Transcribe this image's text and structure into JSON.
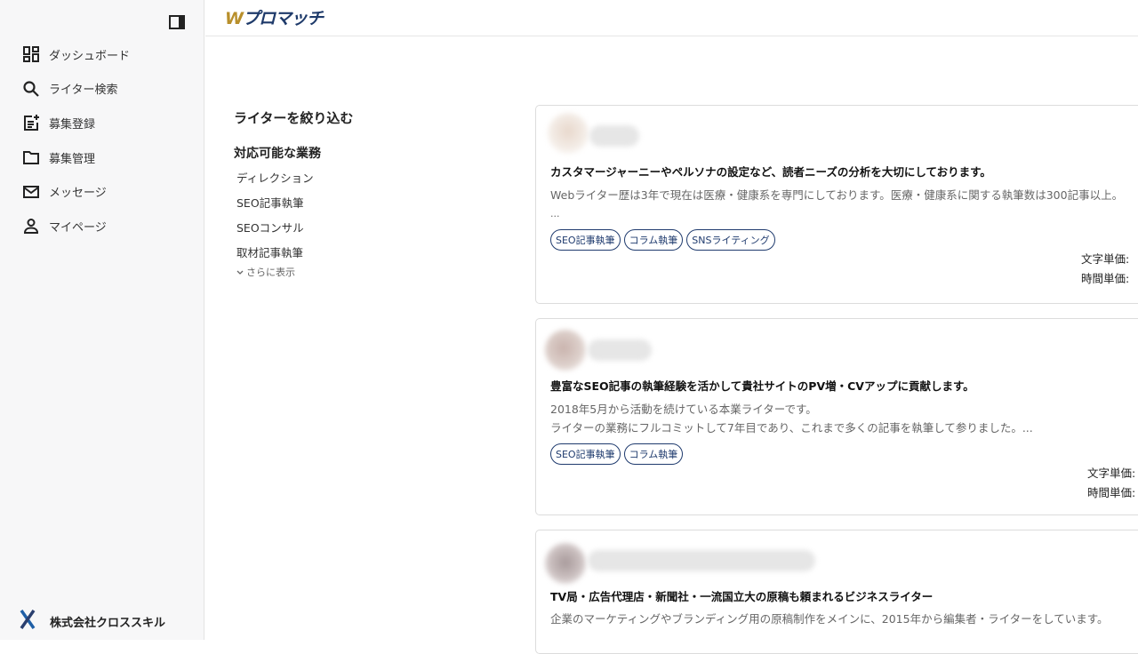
{
  "logo": {
    "w": "W",
    "rest": "プロマッチ"
  },
  "sidebar": {
    "items": [
      {
        "icon": "dashboard-icon",
        "label": "ダッシュボード"
      },
      {
        "icon": "search-icon",
        "label": "ライター検索"
      },
      {
        "icon": "post-add-icon",
        "label": "募集登録"
      },
      {
        "icon": "folder-icon",
        "label": "募集管理"
      },
      {
        "icon": "mail-icon",
        "label": "メッセージ"
      },
      {
        "icon": "person-icon",
        "label": "マイページ"
      }
    ],
    "company": "株式会社クロススキル"
  },
  "filter": {
    "title": "ライターを絞り込む",
    "section_title": "対応可能な業務",
    "options": [
      "ディレクション",
      "SEO記事執筆",
      "SEOコンサル",
      "取材記事執筆"
    ],
    "more": "さらに表示"
  },
  "cards": [
    {
      "title": "カスタマージャーニーやペルソナの設定など、読者ニーズの分析を大切にしております。",
      "desc1": "Webライター歴は3年で現在は医療・健康系を専門にしております。医療・健康系に関する執筆数は300記事以上。",
      "desc2": "...",
      "tags": [
        "SEO記事執筆",
        "コラム執筆",
        "SNSライティング"
      ],
      "price_char": "文字単価:",
      "price_hour": "時間単価:"
    },
    {
      "title": "豊富なSEO記事の執筆経験を活かして貴社サイトのPV増・CVアップに貢献します。",
      "desc1": "2018年5月から活動を続けている本業ライターです。",
      "desc2": "ライターの業務にフルコミットして7年目であり、これまで多くの記事を執筆して参りました。...",
      "tags": [
        "SEO記事執筆",
        "コラム執筆"
      ],
      "price_char": "文字単価:",
      "price_hour": "時間単価:"
    },
    {
      "title": "TV局・広告代理店・新聞社・一流国立大の原稿も頼まれるビジネスライター",
      "desc1": "企業のマーケティングやブランディング用の原稿制作をメインに、2015年から編集者・ライターをしています。"
    }
  ],
  "colors": {
    "accent": "#1f3b6e",
    "logo_gold": "#b88f2b",
    "sidebar_bg": "#f7f7f8"
  }
}
